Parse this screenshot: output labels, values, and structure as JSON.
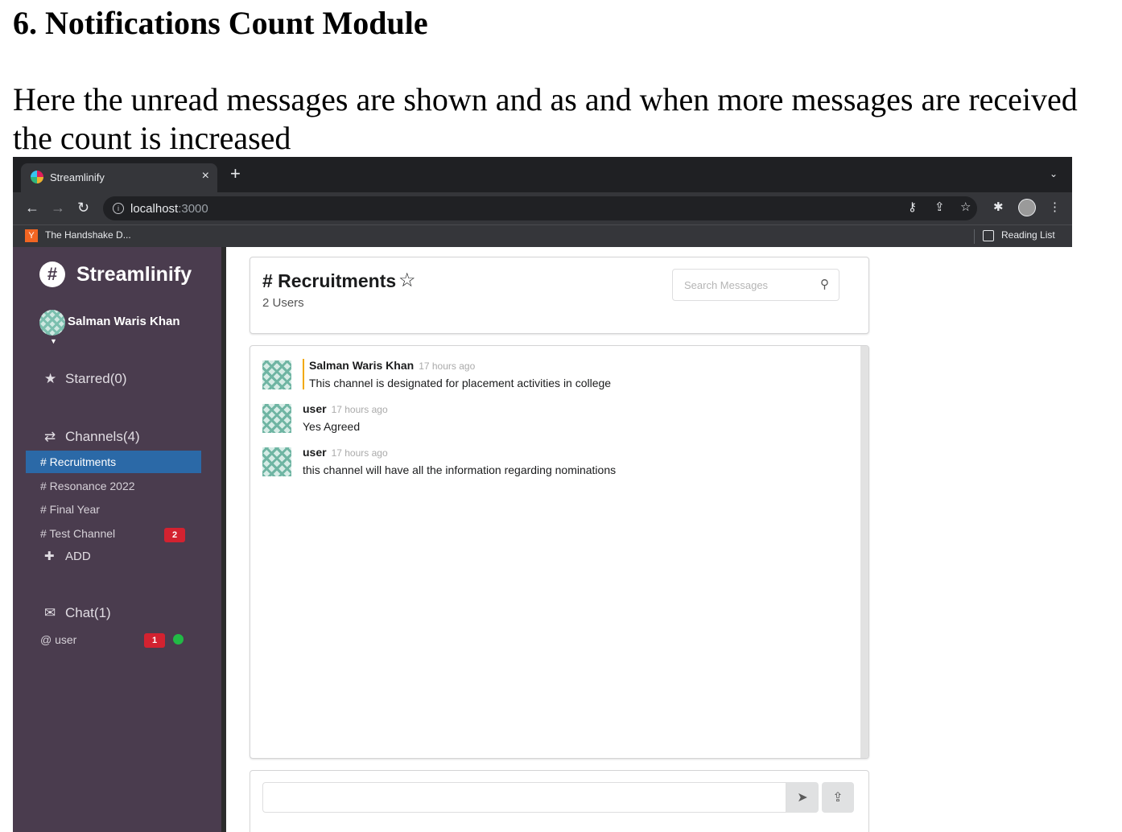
{
  "doc": {
    "heading": "6. Notifications Count Module",
    "paragraph": "Here the unread messages are shown and as and when more messages are received the count is increased"
  },
  "browser": {
    "tab_title": "Streamlinify",
    "tab_close": "×",
    "new_tab": "+",
    "tab_menu": "⌄",
    "url_host": "localhost",
    "url_port": ":3000",
    "bookmark_label": "The Handshake D...",
    "bookmark_icon_letter": "Y",
    "reading_list": "Reading List"
  },
  "sidebar": {
    "app_name": "Streamlinify",
    "user_name": "Salman Waris Khan",
    "starred": "Starred(0)",
    "channels_header": "Channels(4)",
    "channels": [
      {
        "label": "# Recruitments",
        "active": true
      },
      {
        "label": "# Resonance 2022"
      },
      {
        "label": "# Final Year"
      },
      {
        "label": "# Test Channel",
        "unread": "2"
      }
    ],
    "add_label": "ADD",
    "chat_header": "Chat(1)",
    "dms": [
      {
        "label": "@ user",
        "unread": "1",
        "online": true
      }
    ]
  },
  "header": {
    "channel_title": "# Recruitments",
    "user_count": "2 Users",
    "search_placeholder": "Search Messages"
  },
  "messages": [
    {
      "author": "Salman Waris Khan",
      "time": "17 hours ago",
      "text": "This channel is designated for placement activities in college",
      "own": true
    },
    {
      "author": "user",
      "time": "17 hours ago",
      "text": "Yes Agreed"
    },
    {
      "author": "user",
      "time": "17 hours ago",
      "text": "this channel will have all the information regarding nominations"
    }
  ],
  "colors": {
    "sidebar_bg": "#4a3c4e",
    "active_channel": "#2b69a7",
    "badge_red": "#d32230",
    "online_green": "#21ba45"
  }
}
